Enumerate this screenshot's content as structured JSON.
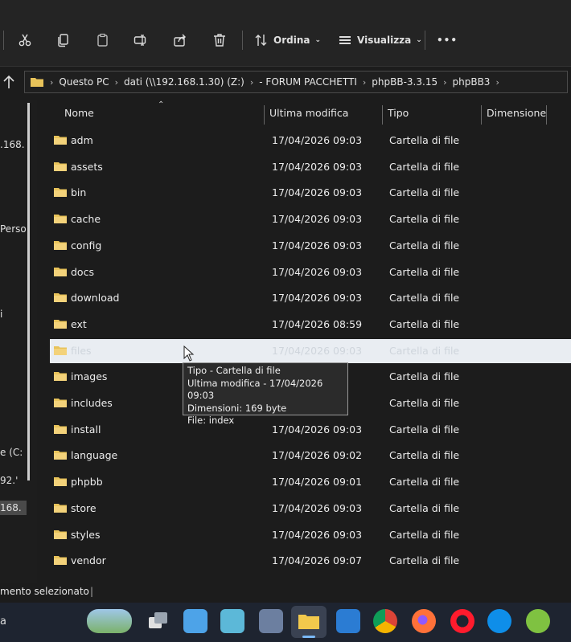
{
  "toolbar": {
    "cut": "cut-icon",
    "copy": "copy-icon",
    "paste": "paste-icon",
    "rename": "rename-icon",
    "share": "share-icon",
    "delete": "trash-icon",
    "sort_label": "Ordina",
    "view_label": "Visualizza",
    "more": "•••"
  },
  "address": {
    "crumbs": [
      "Questo PC",
      "dati (\\\\192.168.1.30) (Z:)",
      "- FORUM PACCHETTI",
      "phpBB-3.3.15",
      "phpBB3"
    ]
  },
  "nav": {
    "fragments": [
      ".168.",
      "Perso",
      "i",
      "e (C:",
      "92.'",
      "168."
    ]
  },
  "columns": {
    "name": "Nome",
    "modified": "Ultima modifica",
    "type": "Tipo",
    "size": "Dimensione"
  },
  "files": [
    {
      "name": "adm",
      "modified": "17/04/2026 09:03",
      "type": "Cartella di file"
    },
    {
      "name": "assets",
      "modified": "17/04/2026 09:03",
      "type": "Cartella di file"
    },
    {
      "name": "bin",
      "modified": "17/04/2026 09:03",
      "type": "Cartella di file"
    },
    {
      "name": "cache",
      "modified": "17/04/2026 09:03",
      "type": "Cartella di file"
    },
    {
      "name": "config",
      "modified": "17/04/2026 09:03",
      "type": "Cartella di file"
    },
    {
      "name": "docs",
      "modified": "17/04/2026 09:03",
      "type": "Cartella di file"
    },
    {
      "name": "download",
      "modified": "17/04/2026 09:03",
      "type": "Cartella di file"
    },
    {
      "name": "ext",
      "modified": "17/04/2026 08:59",
      "type": "Cartella di file"
    },
    {
      "name": "files",
      "modified": "17/04/2026 09:03",
      "type": "Cartella di file"
    },
    {
      "name": "images",
      "modified": "",
      "type": "Cartella di file"
    },
    {
      "name": "includes",
      "modified": "",
      "type": "Cartella di file"
    },
    {
      "name": "install",
      "modified": "17/04/2026 09:03",
      "type": "Cartella di file"
    },
    {
      "name": "language",
      "modified": "17/04/2026 09:02",
      "type": "Cartella di file"
    },
    {
      "name": "phpbb",
      "modified": "17/04/2026 09:01",
      "type": "Cartella di file"
    },
    {
      "name": "store",
      "modified": "17/04/2026 09:03",
      "type": "Cartella di file"
    },
    {
      "name": "styles",
      "modified": "17/04/2026 09:03",
      "type": "Cartella di file"
    },
    {
      "name": "vendor",
      "modified": "17/04/2026 09:07",
      "type": "Cartella di file"
    }
  ],
  "selected_index": 8,
  "tooltip": {
    "line1": "Tipo - Cartella di file",
    "line2": "Ultima modifica - 17/04/2026 09:03",
    "line3": "Dimensioni: 169 byte",
    "line4": "File: index"
  },
  "status": {
    "text": "mento selezionato",
    "separator": "|"
  },
  "taskbar": {
    "search_fragment": "a",
    "apps": [
      "widgets-icon",
      "task-view-icon",
      "snap-icon",
      "photos-icon",
      "calculator-icon",
      "file-explorer-icon",
      "outlook-icon",
      "chrome-icon",
      "firefox-icon",
      "opera-icon",
      "teamviewer-icon",
      "notepadpp-icon"
    ]
  },
  "colors": {
    "folder": "#e8c35a",
    "selection": "#e9edf2",
    "background": "#1c1c1c"
  }
}
